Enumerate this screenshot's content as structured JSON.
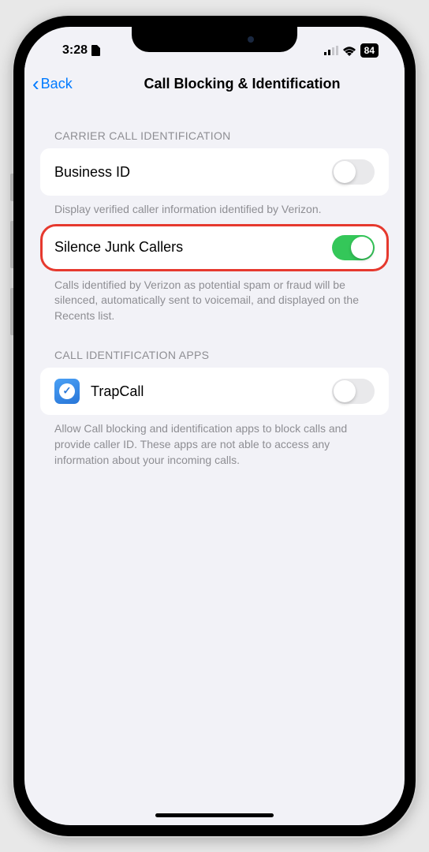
{
  "status_bar": {
    "time": "3:28",
    "battery": "84"
  },
  "nav": {
    "back_label": "Back",
    "title": "Call Blocking & Identification"
  },
  "sections": {
    "carrier": {
      "header": "CARRIER CALL IDENTIFICATION",
      "business_id": {
        "label": "Business ID",
        "footer": "Display verified caller information identified by Verizon.",
        "enabled": false
      },
      "silence_junk": {
        "label": "Silence Junk Callers",
        "footer": "Calls identified by Verizon as potential spam or fraud will be silenced, automatically sent to voicemail, and displayed on the Recents list.",
        "enabled": true
      }
    },
    "apps": {
      "header": "CALL IDENTIFICATION APPS",
      "trapcall": {
        "label": "TrapCall",
        "enabled": false
      },
      "footer": "Allow Call blocking and identification apps to block calls and provide caller ID. These apps are not able to access any information about your incoming calls."
    }
  }
}
